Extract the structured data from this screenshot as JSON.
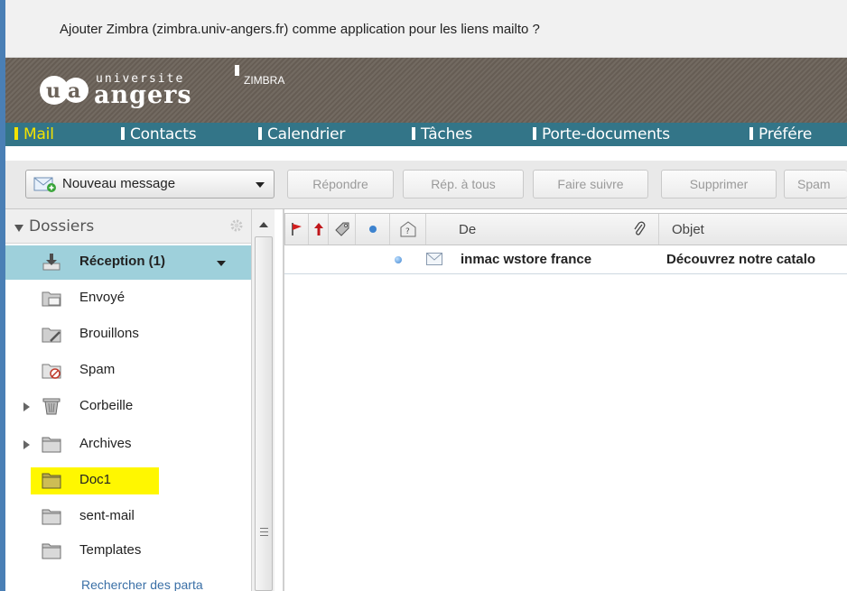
{
  "notification": {
    "text": "Ajouter Zimbra (zimbra.univ-angers.fr) comme application pour les liens mailto ?"
  },
  "header": {
    "logo_top": "universite",
    "logo_main": "angers",
    "logo_sub": "ZIMBRA"
  },
  "tabs": [
    {
      "label": "Mail",
      "active": true
    },
    {
      "label": "Contacts"
    },
    {
      "label": "Calendrier"
    },
    {
      "label": "Tâches"
    },
    {
      "label": "Porte-documents"
    },
    {
      "label": "Préfére"
    }
  ],
  "toolbar": {
    "new_message": "Nouveau message",
    "reply": "Répondre",
    "reply_all": "Rép. à tous",
    "forward": "Faire suivre",
    "delete": "Supprimer",
    "spam": "Spam"
  },
  "sidebar": {
    "header": "Dossiers",
    "folders": [
      {
        "name": "Réception (1)",
        "icon": "inbox-icon",
        "selected": true
      },
      {
        "name": "Envoyé",
        "icon": "sent-folder-icon"
      },
      {
        "name": "Brouillons",
        "icon": "drafts-folder-icon"
      },
      {
        "name": "Spam",
        "icon": "spam-folder-icon"
      },
      {
        "name": "Corbeille",
        "icon": "trash-icon",
        "expandable": true
      },
      {
        "name": "Archives",
        "icon": "folder-icon",
        "expandable": true
      },
      {
        "name": "Doc1",
        "icon": "folder-icon",
        "highlighted": true
      },
      {
        "name": "sent-mail",
        "icon": "folder-icon"
      },
      {
        "name": "Templates",
        "icon": "folder-icon"
      }
    ],
    "search_shared": "Rechercher des parta"
  },
  "message_list": {
    "columns": {
      "from": "De",
      "subject": "Objet"
    },
    "rows": [
      {
        "from": "inmac wstore france",
        "subject": "Découvrez notre catalo",
        "unread": true
      }
    ]
  },
  "colors": {
    "header_bg": "#6b6259",
    "tab_bar": "#337588",
    "active_tab": "#f3e300",
    "selected_folder": "#9ed0db",
    "highlight": "#fff700"
  }
}
